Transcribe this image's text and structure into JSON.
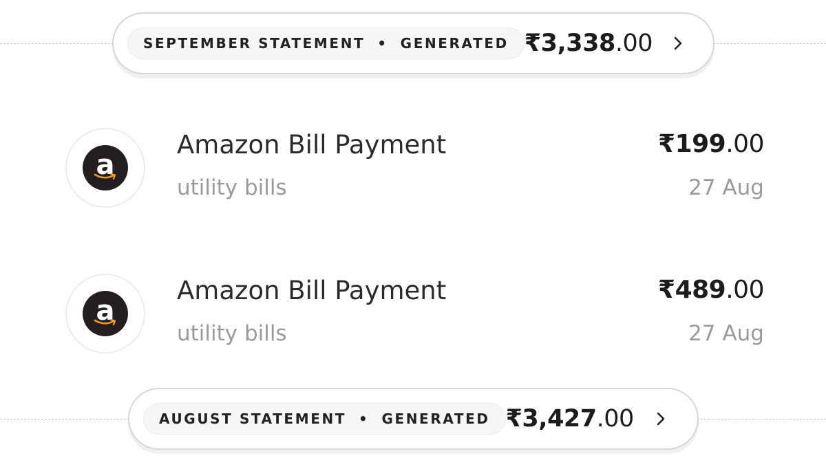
{
  "statements": [
    {
      "month_label": "SEPTEMBER STATEMENT",
      "separator": "•",
      "status": "GENERATED",
      "amount_whole": "₹3,338",
      "amount_fraction": ".00"
    },
    {
      "month_label": "AUGUST STATEMENT",
      "separator": "•",
      "status": "GENERATED",
      "amount_whole": "₹3,427",
      "amount_fraction": ".00"
    }
  ],
  "transactions": [
    {
      "merchant": "Amazon Bill Payment",
      "category": "utility bills",
      "amount_whole": "₹199",
      "amount_fraction": ".00",
      "date": "27 Aug",
      "logo_letter": "a",
      "logo_icon": "amazon-logo-icon"
    },
    {
      "merchant": "Amazon Bill Payment",
      "category": "utility bills",
      "amount_whole": "₹489",
      "amount_fraction": ".00",
      "date": "27 Aug",
      "logo_letter": "a",
      "logo_icon": "amazon-logo-icon"
    }
  ],
  "colors": {
    "logo_background": "#231f20",
    "amazon_smile": "#f29a1f",
    "secondary_text": "#9a9a9a"
  }
}
